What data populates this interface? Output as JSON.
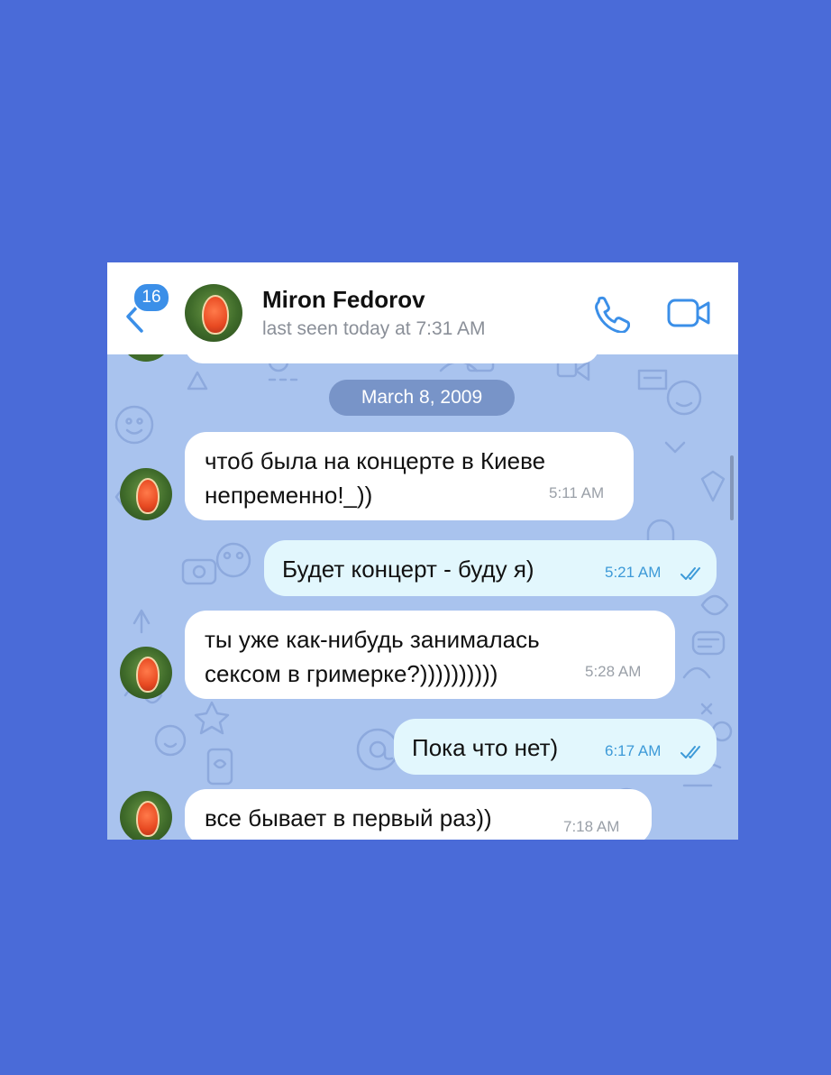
{
  "header": {
    "unread_count": "16",
    "contact_name": "Miron Fedorov",
    "status": "last seen today at 7:31 AM",
    "call_icon": "phone-icon",
    "video_icon": "video-camera-icon"
  },
  "chat": {
    "date_label": "March 8, 2009",
    "messages": [
      {
        "direction": "in",
        "lines": [
          "чтоб была на концерте в Киеве",
          "непременно!_))"
        ],
        "time": "5:11 AM"
      },
      {
        "direction": "out",
        "lines": [
          "Будет концерт - буду я)"
        ],
        "time": "5:21 AM",
        "read": true
      },
      {
        "direction": "in",
        "lines": [
          "ты уже как-нибудь занималась",
          "сексом в гримерке?))))))))))"
        ],
        "time": "5:28 AM"
      },
      {
        "direction": "out",
        "lines": [
          "Пока что нет)"
        ],
        "time": "6:17 AM",
        "read": true
      },
      {
        "direction": "in",
        "lines": [
          "все бывает в первый раз))"
        ],
        "time": "7:18 AM"
      }
    ]
  },
  "colors": {
    "page_background": "#4a6bd8",
    "chat_wallpaper": "#a9c3ee",
    "incoming_bubble": "#ffffff",
    "outgoing_bubble": "#e2f7fd",
    "accent": "#3b8fe8"
  }
}
